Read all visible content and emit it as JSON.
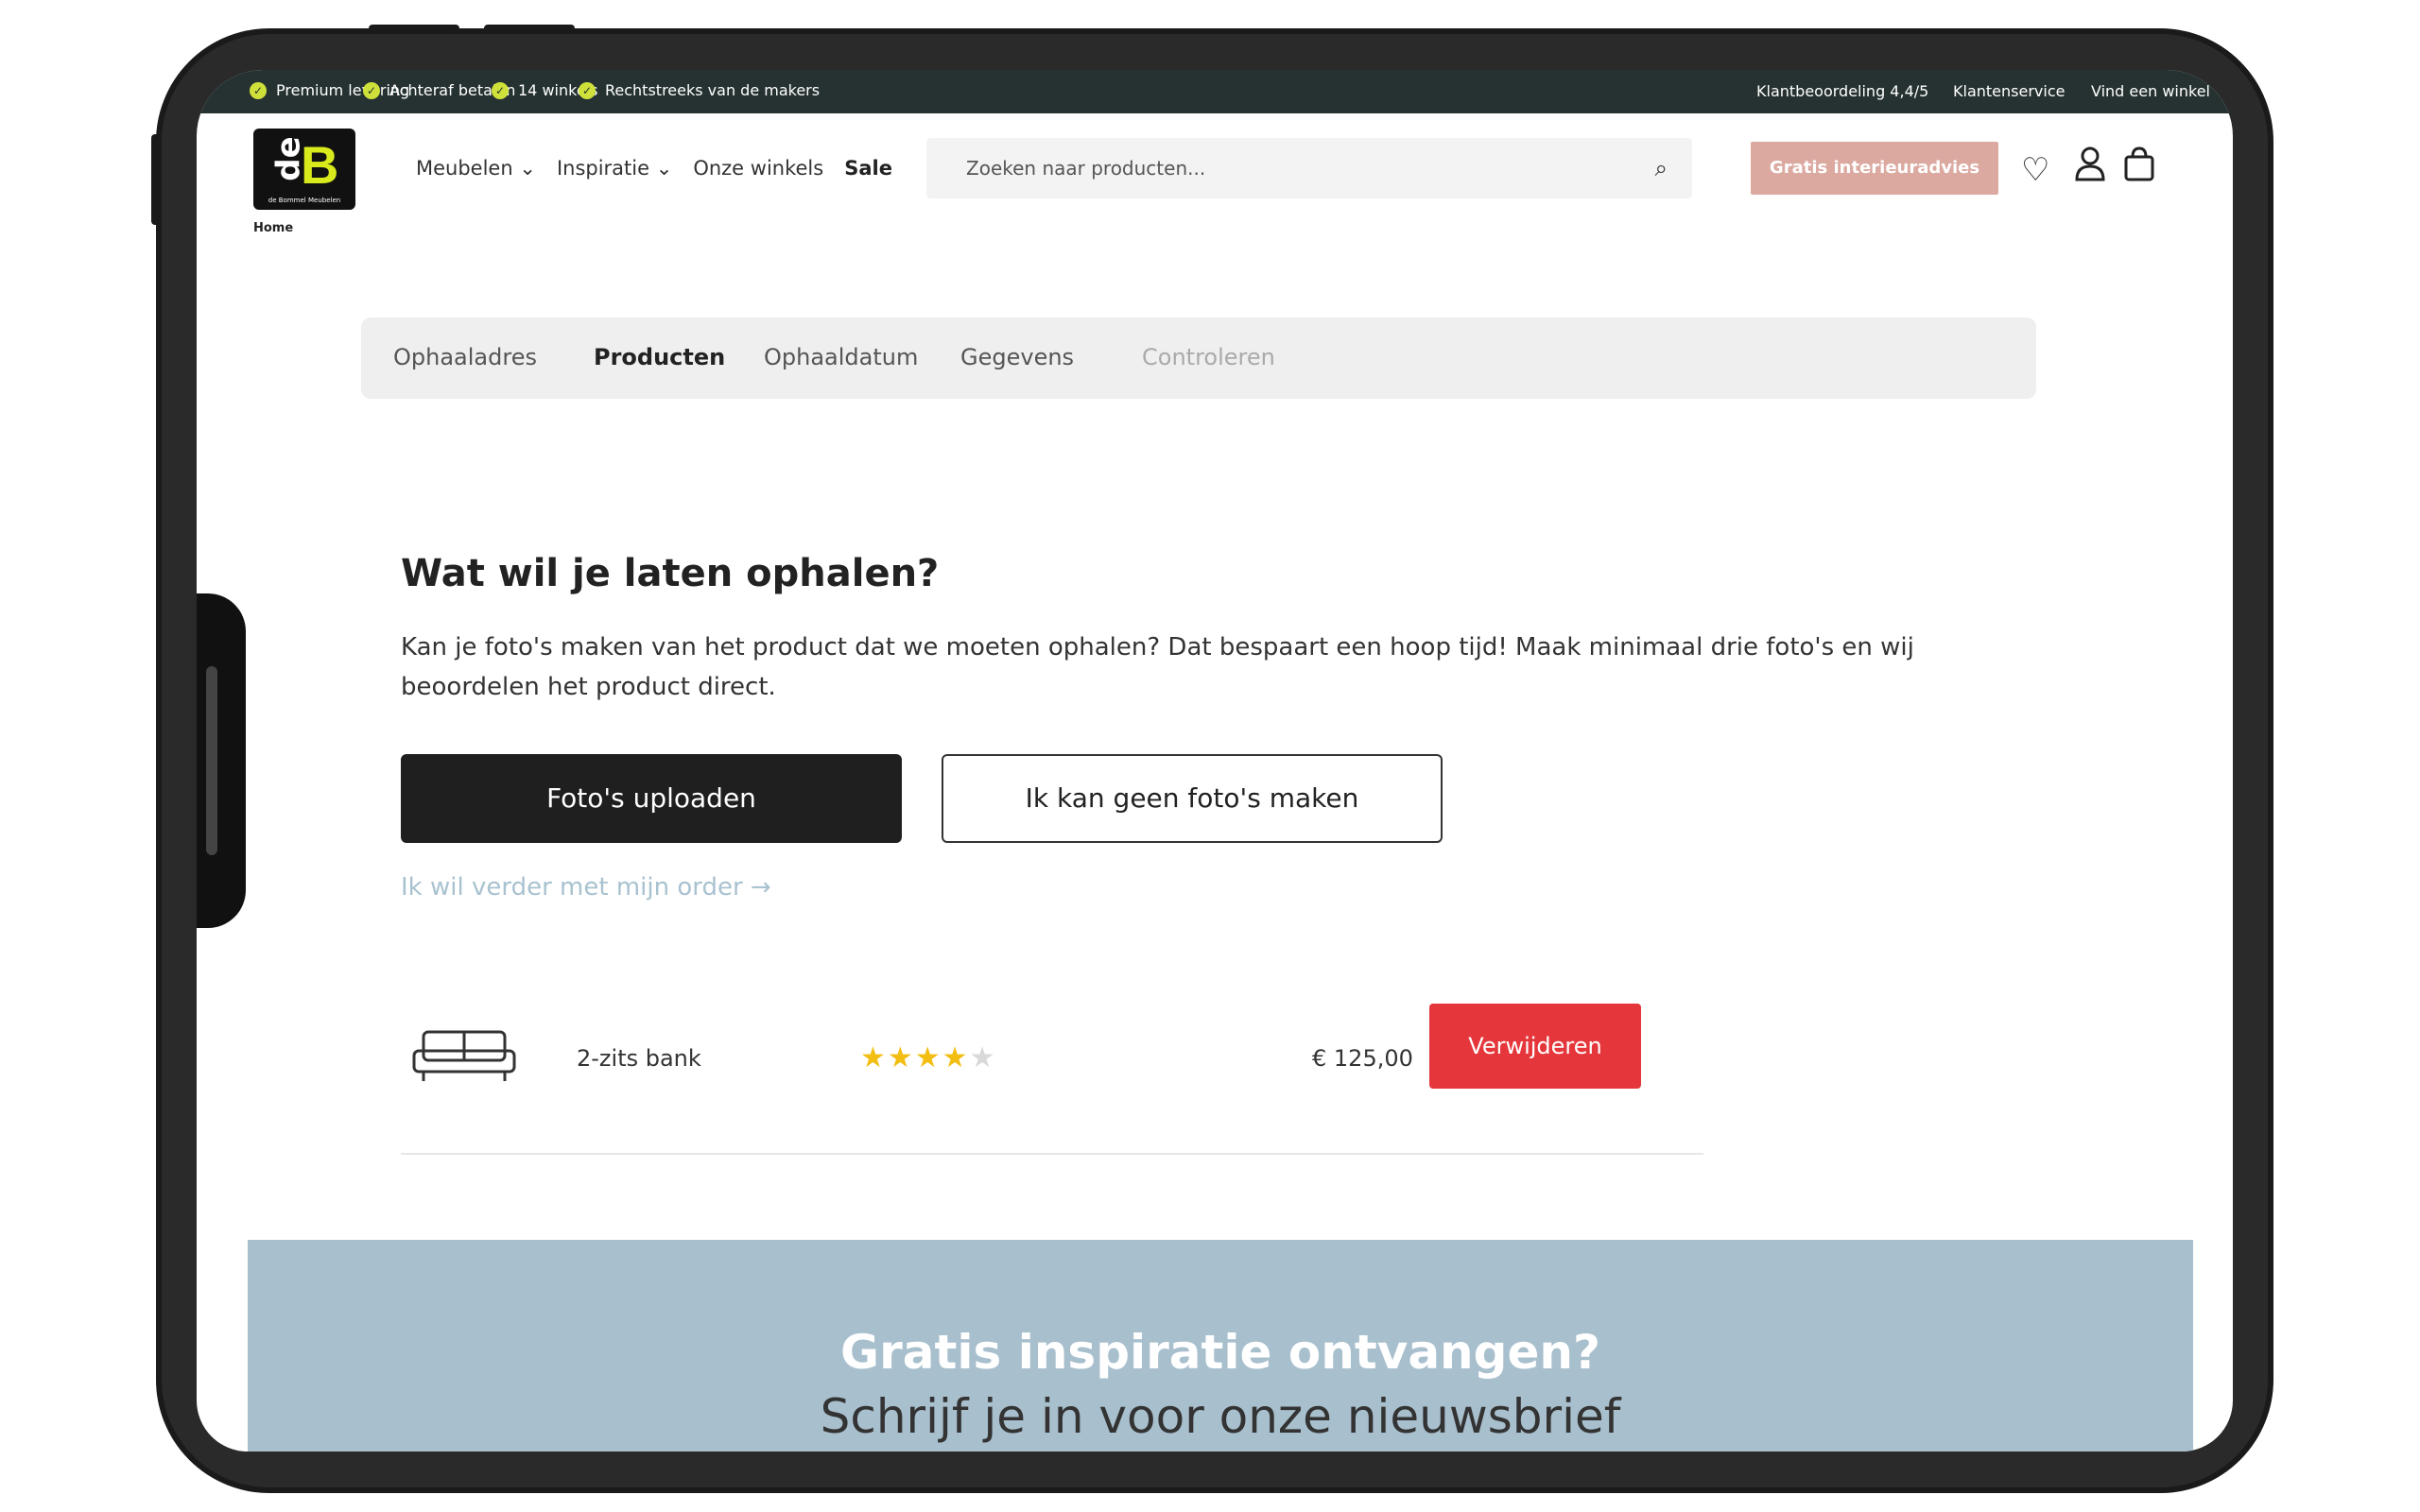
{
  "topbar": {
    "usps": [
      "Premium levering",
      "Achteraf betalen",
      "14 winkels",
      "Rechtstreeks van de makers"
    ],
    "rating": "Klantbeoordeling 4,4/5",
    "service": "Klantenservice",
    "store": "Vind een winkel"
  },
  "logo": {
    "de": "de",
    "b": "B",
    "tagline": "de Bommel Meubelen"
  },
  "breadcrumb": "Home",
  "nav": {
    "meubelen": "Meubelen ⌄",
    "inspiratie": "Inspiratie ⌄",
    "winkels": "Onze winkels",
    "sale": "Sale"
  },
  "search": {
    "placeholder": "Zoeken naar producten..."
  },
  "advies_button": "Gratis interieuradvies",
  "steps": [
    "Ophaaladres",
    "Producten",
    "Ophaaldatum",
    "Gegevens",
    "Controleren"
  ],
  "main": {
    "title": "Wat wil je laten ophalen?",
    "intro": "Kan je foto's maken van het product dat we moeten ophalen? Dat bespaart een hoop tijd! Maak minimaal drie foto's en wij beoordelen het product direct.",
    "upload_button": "Foto's uploaden",
    "no_photo_button": "Ik kan geen foto's maken",
    "continue_link": "Ik wil verder met mijn order →"
  },
  "product": {
    "name": "2-zits bank",
    "rating": 4,
    "rating_max": 5,
    "stars_on": "★★★★",
    "stars_off": "★",
    "price": "€ 125,00",
    "remove_button": "Verwijderen"
  },
  "newsletter": {
    "title": "Gratis inspiratie ontvangen?",
    "subtitle": "Schrijf je in voor onze nieuwsbrief"
  }
}
